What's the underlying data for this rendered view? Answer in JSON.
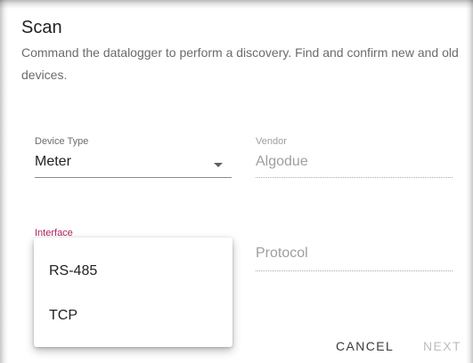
{
  "dialog": {
    "title": "Scan",
    "description": "Command the datalogger to perform a discovery. Find and confirm new and old devices."
  },
  "form": {
    "device_type": {
      "label": "Device Type",
      "value": "Meter"
    },
    "vendor": {
      "label": "Vendor",
      "value": "Algodue"
    },
    "interface": {
      "label": "Interface",
      "options": [
        "RS-485",
        "TCP"
      ]
    },
    "protocol": {
      "label": "Protocol"
    }
  },
  "actions": {
    "cancel_label": "CANCEL",
    "next_label": "NEXT"
  },
  "colors": {
    "accent": "#b0245e",
    "text_primary": "#212121",
    "text_secondary": "#6b6b6b",
    "disabled": "#bdbdbd"
  },
  "icons": {
    "dropdown": "caret-down-icon"
  }
}
